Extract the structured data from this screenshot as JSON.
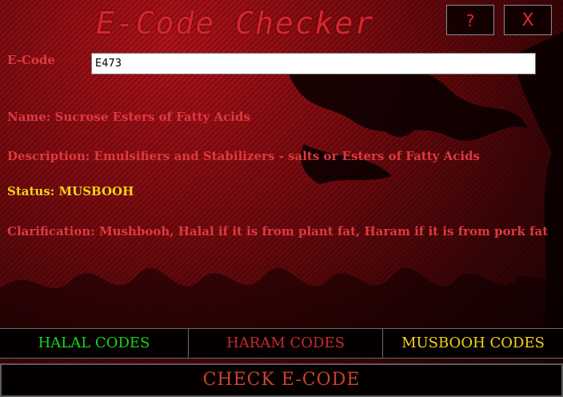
{
  "window": {
    "title": "E-Code Checker",
    "help_label": "?",
    "close_label": "X"
  },
  "form": {
    "ecode_label": "E-Code",
    "ecode_value": "E473"
  },
  "result": {
    "name": "Name: Sucrose Esters of Fatty Acids",
    "description": "Description: Emulsifiers and Stabilizers - salts or Esters of Fatty Acids",
    "status": "Status: MUSBOOH",
    "clarification": "Clarification: Mushbooh, Halal if it is from plant fat, Haram if it is from pork fat"
  },
  "code_buttons": {
    "halal": "HALAL CODES",
    "haram": "HARAM CODES",
    "musbooh": "MUSBOOH CODES"
  },
  "check_button": "CHECK E-CODE",
  "colors": {
    "accent_red": "#e0393f",
    "status_yellow": "#f2d21b",
    "halal_green": "#19d21e",
    "check_orange": "#c8442a"
  }
}
